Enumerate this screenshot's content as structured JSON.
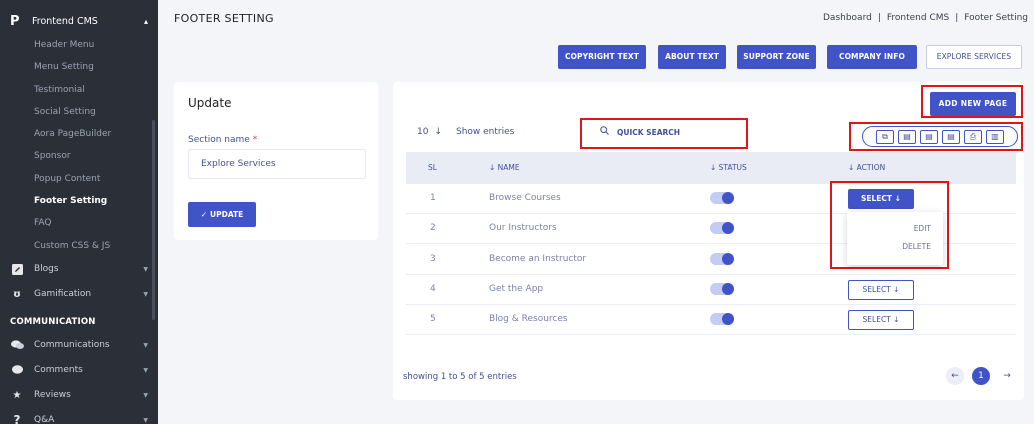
{
  "sidebar": {
    "header": {
      "logo": "P",
      "label": "Frontend CMS"
    },
    "sub_items": [
      {
        "label": "Header Menu",
        "active": false
      },
      {
        "label": "Menu Setting",
        "active": false
      },
      {
        "label": "Testimonial",
        "active": false
      },
      {
        "label": "Social Setting",
        "active": false
      },
      {
        "label": "Aora PageBuilder",
        "active": false
      },
      {
        "label": "Sponsor",
        "active": false
      },
      {
        "label": "Popup Content",
        "active": false
      },
      {
        "label": "Footer Setting",
        "active": true
      },
      {
        "label": "FAQ",
        "active": false
      },
      {
        "label": "Custom CSS & JS",
        "active": false
      }
    ],
    "main_items": [
      {
        "label": "Blogs",
        "icon": "edit-icon"
      },
      {
        "label": "Gamification",
        "icon": "gamification-icon"
      }
    ],
    "section_label": "COMMUNICATION",
    "comm_items": [
      {
        "label": "Communications",
        "icon": "chat-icon"
      },
      {
        "label": "Comments",
        "icon": "comment-icon"
      },
      {
        "label": "Reviews",
        "icon": "star-icon"
      },
      {
        "label": "Q&A",
        "icon": "question-icon"
      }
    ]
  },
  "header": {
    "title": "FOOTER SETTING",
    "breadcrumb": [
      "Dashboard",
      "Frontend CMS",
      "Footer Setting"
    ]
  },
  "tabs": [
    {
      "label": "COPYRIGHT TEXT"
    },
    {
      "label": "ABOUT TEXT"
    },
    {
      "label": "SUPPORT ZONE"
    },
    {
      "label": "COMPANY INFO"
    },
    {
      "label": "EXPLORE SERVICES"
    }
  ],
  "update_form": {
    "title": "Update",
    "field_label": "Section name",
    "required_mark": "*",
    "field_value": "Explore Services",
    "button_label": "UPDATE"
  },
  "table": {
    "add_new_label": "ADD NEW PAGE",
    "entries_count": "10",
    "show_entries_label": "Show entries",
    "search_label": "QUICK SEARCH",
    "columns": [
      "SL",
      "NAME",
      "STATUS",
      "ACTION"
    ],
    "rows": [
      {
        "sl": "1",
        "name": "Browse Courses",
        "status": true
      },
      {
        "sl": "2",
        "name": "Our Instructors",
        "status": true
      },
      {
        "sl": "3",
        "name": "Become an Instructor",
        "status": true
      },
      {
        "sl": "4",
        "name": "Get the App",
        "status": true
      },
      {
        "sl": "5",
        "name": "Blog & Resources",
        "status": true
      }
    ],
    "select_label": "SELECT",
    "dropdown_items": [
      "EDIT",
      "DELETE"
    ],
    "showing_text": "showing 1 to 5 of 5 entries",
    "current_page": "1"
  },
  "colors": {
    "accent": "#4054c8",
    "sidebar_bg": "#2b3038",
    "highlight": "#e01515"
  }
}
